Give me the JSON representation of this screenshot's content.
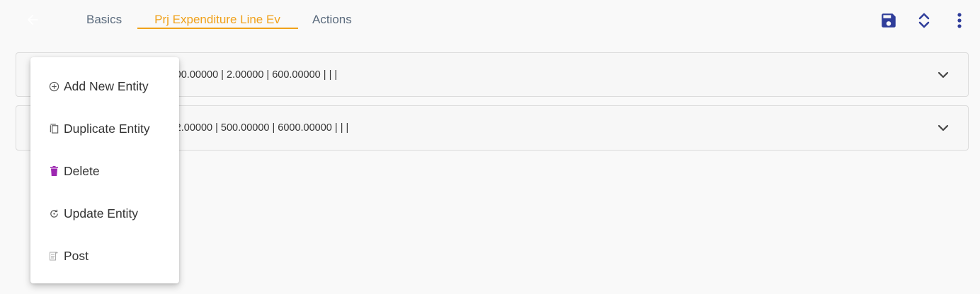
{
  "header": {
    "back_icon": "arrow-left-icon",
    "tabs": [
      {
        "label": "Basics"
      },
      {
        "label": "Prj Expenditure Line Ev",
        "active": true
      },
      {
        "label": "Actions"
      }
    ],
    "accent_color": "#f0a11a",
    "action_icons": [
      "save-icon",
      "unfold-icon",
      "more-vert-icon"
    ]
  },
  "rows": [
    {
      "text": "intenance  | equipment |  | Ea | 300.00000 | 2.00000 | 600.00000 |  |  |"
    },
    {
      "text": "intenance  | equipment |  | Ea | 12.00000 | 500.00000 | 6000.00000 |  |  |"
    }
  ],
  "menu": {
    "items": [
      {
        "label": "Add New Entity",
        "icon": "add-circle-icon"
      },
      {
        "label": "Duplicate Entity",
        "icon": "copy-icon"
      },
      {
        "label": "Delete",
        "icon": "trash-icon",
        "icon_color": "#9c27b0"
      },
      {
        "label": "Update Entity",
        "icon": "refresh-icon"
      },
      {
        "label": "Post",
        "icon": "post-icon"
      }
    ]
  }
}
